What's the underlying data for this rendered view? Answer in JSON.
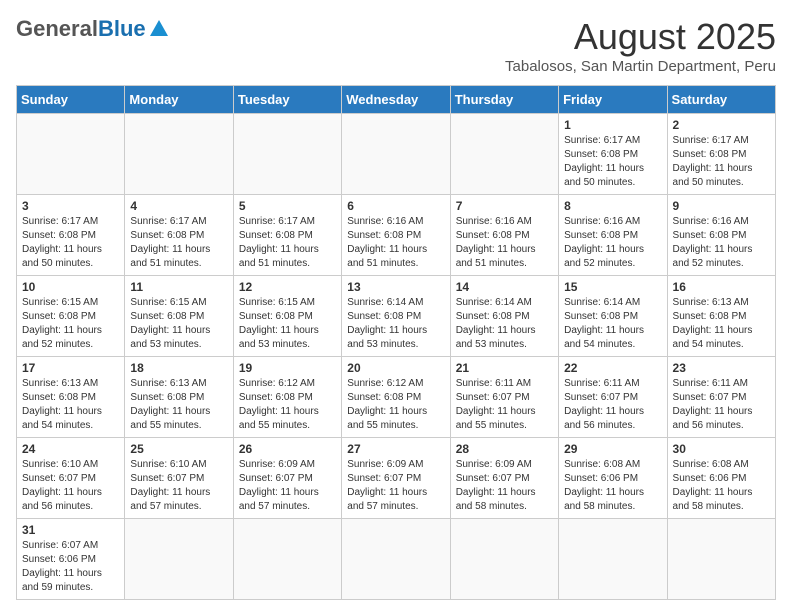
{
  "header": {
    "logo_general": "General",
    "logo_blue": "Blue",
    "month_title": "August 2025",
    "location": "Tabalosos, San Martin Department, Peru"
  },
  "days_of_week": [
    "Sunday",
    "Monday",
    "Tuesday",
    "Wednesday",
    "Thursday",
    "Friday",
    "Saturday"
  ],
  "weeks": [
    [
      {
        "day": "",
        "info": ""
      },
      {
        "day": "",
        "info": ""
      },
      {
        "day": "",
        "info": ""
      },
      {
        "day": "",
        "info": ""
      },
      {
        "day": "",
        "info": ""
      },
      {
        "day": "1",
        "info": "Sunrise: 6:17 AM\nSunset: 6:08 PM\nDaylight: 11 hours and 50 minutes."
      },
      {
        "day": "2",
        "info": "Sunrise: 6:17 AM\nSunset: 6:08 PM\nDaylight: 11 hours and 50 minutes."
      }
    ],
    [
      {
        "day": "3",
        "info": "Sunrise: 6:17 AM\nSunset: 6:08 PM\nDaylight: 11 hours and 50 minutes."
      },
      {
        "day": "4",
        "info": "Sunrise: 6:17 AM\nSunset: 6:08 PM\nDaylight: 11 hours and 51 minutes."
      },
      {
        "day": "5",
        "info": "Sunrise: 6:17 AM\nSunset: 6:08 PM\nDaylight: 11 hours and 51 minutes."
      },
      {
        "day": "6",
        "info": "Sunrise: 6:16 AM\nSunset: 6:08 PM\nDaylight: 11 hours and 51 minutes."
      },
      {
        "day": "7",
        "info": "Sunrise: 6:16 AM\nSunset: 6:08 PM\nDaylight: 11 hours and 51 minutes."
      },
      {
        "day": "8",
        "info": "Sunrise: 6:16 AM\nSunset: 6:08 PM\nDaylight: 11 hours and 52 minutes."
      },
      {
        "day": "9",
        "info": "Sunrise: 6:16 AM\nSunset: 6:08 PM\nDaylight: 11 hours and 52 minutes."
      }
    ],
    [
      {
        "day": "10",
        "info": "Sunrise: 6:15 AM\nSunset: 6:08 PM\nDaylight: 11 hours and 52 minutes."
      },
      {
        "day": "11",
        "info": "Sunrise: 6:15 AM\nSunset: 6:08 PM\nDaylight: 11 hours and 53 minutes."
      },
      {
        "day": "12",
        "info": "Sunrise: 6:15 AM\nSunset: 6:08 PM\nDaylight: 11 hours and 53 minutes."
      },
      {
        "day": "13",
        "info": "Sunrise: 6:14 AM\nSunset: 6:08 PM\nDaylight: 11 hours and 53 minutes."
      },
      {
        "day": "14",
        "info": "Sunrise: 6:14 AM\nSunset: 6:08 PM\nDaylight: 11 hours and 53 minutes."
      },
      {
        "day": "15",
        "info": "Sunrise: 6:14 AM\nSunset: 6:08 PM\nDaylight: 11 hours and 54 minutes."
      },
      {
        "day": "16",
        "info": "Sunrise: 6:13 AM\nSunset: 6:08 PM\nDaylight: 11 hours and 54 minutes."
      }
    ],
    [
      {
        "day": "17",
        "info": "Sunrise: 6:13 AM\nSunset: 6:08 PM\nDaylight: 11 hours and 54 minutes."
      },
      {
        "day": "18",
        "info": "Sunrise: 6:13 AM\nSunset: 6:08 PM\nDaylight: 11 hours and 55 minutes."
      },
      {
        "day": "19",
        "info": "Sunrise: 6:12 AM\nSunset: 6:08 PM\nDaylight: 11 hours and 55 minutes."
      },
      {
        "day": "20",
        "info": "Sunrise: 6:12 AM\nSunset: 6:08 PM\nDaylight: 11 hours and 55 minutes."
      },
      {
        "day": "21",
        "info": "Sunrise: 6:11 AM\nSunset: 6:07 PM\nDaylight: 11 hours and 55 minutes."
      },
      {
        "day": "22",
        "info": "Sunrise: 6:11 AM\nSunset: 6:07 PM\nDaylight: 11 hours and 56 minutes."
      },
      {
        "day": "23",
        "info": "Sunrise: 6:11 AM\nSunset: 6:07 PM\nDaylight: 11 hours and 56 minutes."
      }
    ],
    [
      {
        "day": "24",
        "info": "Sunrise: 6:10 AM\nSunset: 6:07 PM\nDaylight: 11 hours and 56 minutes."
      },
      {
        "day": "25",
        "info": "Sunrise: 6:10 AM\nSunset: 6:07 PM\nDaylight: 11 hours and 57 minutes."
      },
      {
        "day": "26",
        "info": "Sunrise: 6:09 AM\nSunset: 6:07 PM\nDaylight: 11 hours and 57 minutes."
      },
      {
        "day": "27",
        "info": "Sunrise: 6:09 AM\nSunset: 6:07 PM\nDaylight: 11 hours and 57 minutes."
      },
      {
        "day": "28",
        "info": "Sunrise: 6:09 AM\nSunset: 6:07 PM\nDaylight: 11 hours and 58 minutes."
      },
      {
        "day": "29",
        "info": "Sunrise: 6:08 AM\nSunset: 6:06 PM\nDaylight: 11 hours and 58 minutes."
      },
      {
        "day": "30",
        "info": "Sunrise: 6:08 AM\nSunset: 6:06 PM\nDaylight: 11 hours and 58 minutes."
      }
    ],
    [
      {
        "day": "31",
        "info": "Sunrise: 6:07 AM\nSunset: 6:06 PM\nDaylight: 11 hours and 59 minutes."
      },
      {
        "day": "",
        "info": ""
      },
      {
        "day": "",
        "info": ""
      },
      {
        "day": "",
        "info": ""
      },
      {
        "day": "",
        "info": ""
      },
      {
        "day": "",
        "info": ""
      },
      {
        "day": "",
        "info": ""
      }
    ]
  ]
}
